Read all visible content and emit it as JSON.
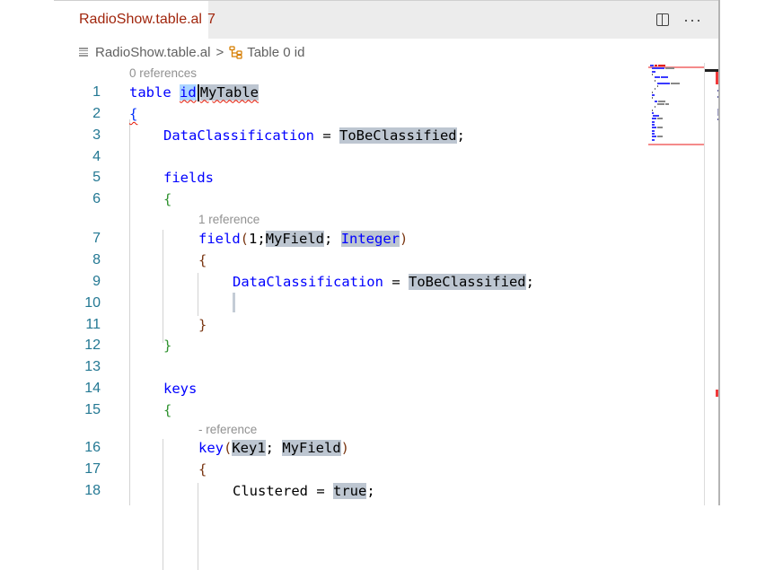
{
  "tab": {
    "file_name": "RadioShow.table.al",
    "problem_count": "7",
    "dirty": true,
    "actions": {
      "split_editor": "split-editor",
      "more": "···"
    }
  },
  "breadcrumb": {
    "file": "RadioShow.table.al",
    "separator": ">",
    "symbol": "Table 0 id"
  },
  "colors": {
    "keyword": "#0000ff",
    "line_number": "#237893",
    "error_tab": "#a1260d",
    "codelens": "#919191",
    "highlight": "#bdc6d1",
    "error": "#e51400"
  },
  "codelens": {
    "l1": "0 references",
    "l7": "1 reference",
    "l16": "- reference"
  },
  "lines": [
    {
      "n": "1"
    },
    {
      "n": "2"
    },
    {
      "n": "3"
    },
    {
      "n": "4"
    },
    {
      "n": "5"
    },
    {
      "n": "6"
    },
    {
      "n": "7"
    },
    {
      "n": "8"
    },
    {
      "n": "9"
    },
    {
      "n": "10"
    },
    {
      "n": "11"
    },
    {
      "n": "12"
    },
    {
      "n": "13"
    },
    {
      "n": "14"
    },
    {
      "n": "15"
    },
    {
      "n": "16"
    },
    {
      "n": "17"
    },
    {
      "n": "18"
    }
  ],
  "code": {
    "l1": {
      "kw": "table",
      "id": "id",
      "name": "MyTable"
    },
    "l2": {
      "brace": "{"
    },
    "l3": {
      "prop": "DataClassification",
      "eq": " = ",
      "val": "ToBeClassified",
      "end": ";"
    },
    "l5": {
      "kw": "fields"
    },
    "l6": {
      "brace": "{"
    },
    "l7": {
      "kw": "field",
      "open": "(",
      "num": "1;",
      "name": "MyField",
      "sep": "; ",
      "type": "Integer",
      "close": ")"
    },
    "l8": {
      "brace": "{"
    },
    "l9": {
      "prop": "DataClassification",
      "eq": " = ",
      "val": "ToBeClassified",
      "end": ";"
    },
    "l11": {
      "brace": "}"
    },
    "l12": {
      "brace": "}"
    },
    "l14": {
      "kw": "keys"
    },
    "l15": {
      "brace": "{"
    },
    "l16": {
      "kw": "key",
      "open": "(",
      "name": "Key1",
      "sep": "; ",
      "field": "MyField",
      "close": ")"
    },
    "l17": {
      "brace": "{"
    },
    "l18": {
      "prop": "Clustered",
      "eq": " = ",
      "val": "true",
      "end": ";"
    }
  }
}
